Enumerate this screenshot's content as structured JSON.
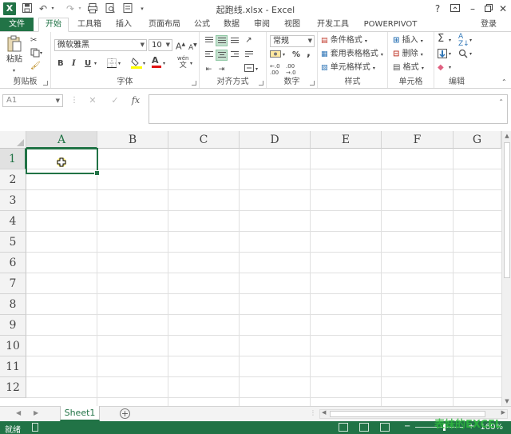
{
  "window": {
    "title": "起跑线.xlsx - Excel",
    "help": "?",
    "signin": "登录"
  },
  "tabs": {
    "file": "文件",
    "items": [
      "开始",
      "工具箱",
      "插入",
      "页面布局",
      "公式",
      "数据",
      "审阅",
      "视图",
      "开发工具",
      "POWERPIVOT"
    ],
    "active": "开始"
  },
  "ribbon": {
    "clipboard": {
      "label": "剪贴板",
      "paste": "粘贴"
    },
    "font": {
      "label": "字体",
      "name": "微软雅黑",
      "size": "10",
      "bold": "B",
      "italic": "I",
      "underline": "U",
      "grow": "A",
      "shrink": "A",
      "font_color_letter": "A",
      "phonetic": "wén"
    },
    "alignment": {
      "label": "对齐方式"
    },
    "number": {
      "label": "数字",
      "format": "常规",
      "percent": "%",
      "comma": ","
    },
    "styles": {
      "label": "样式",
      "conditional": "条件格式",
      "table": "套用表格格式",
      "cell": "单元格样式"
    },
    "cells": {
      "label": "单元格",
      "insert": "插入",
      "delete": "删除",
      "format": "格式"
    },
    "editing": {
      "label": "编辑",
      "sum": "Σ"
    }
  },
  "formula_bar": {
    "name_box": "A1",
    "fx": "fx",
    "value": ""
  },
  "sheet": {
    "columns": [
      "A",
      "B",
      "C",
      "D",
      "E",
      "F",
      "G"
    ],
    "rows": [
      "1",
      "2",
      "3",
      "4",
      "5",
      "6",
      "7",
      "8",
      "9",
      "10",
      "11",
      "12"
    ],
    "active_cell": "A1",
    "tabs": [
      "Sheet1"
    ],
    "add": "+"
  },
  "status": {
    "ready": "就绪",
    "zoom": "160%",
    "minus": "−",
    "plus": "+",
    "watermark": "表妹的EXCEL"
  },
  "colors": {
    "accent": "#217346",
    "selected_bg": "#c5e0cf",
    "header_bg": "#f3f3f3"
  }
}
